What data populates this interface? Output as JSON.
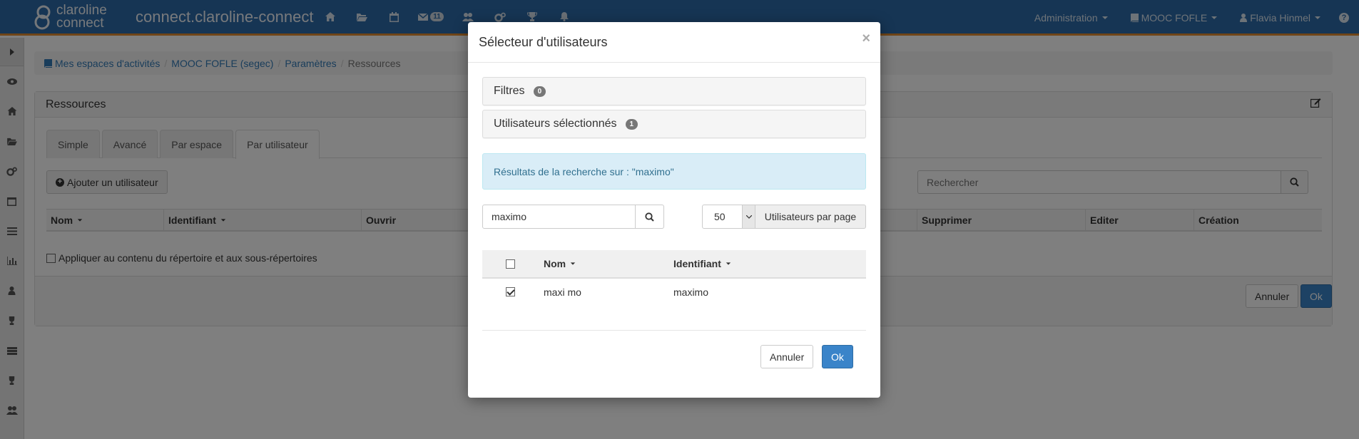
{
  "topnav": {
    "logo_line1": "claroline",
    "logo_line2": "connect",
    "brand": "connect.claroline-connect",
    "messages_count": "11",
    "administration": "Administration",
    "workspace": "MOOC FOFLE",
    "user": "Flavia Hinmel",
    "help": "?"
  },
  "breadcrumb": {
    "items": [
      "Mes espaces d'activités",
      "MOOC FOFLE (segec)",
      "Paramètres"
    ],
    "active": "Ressources"
  },
  "panel": {
    "title": "Ressources",
    "tabs": [
      "Simple",
      "Avancé",
      "Par espace",
      "Par utilisateur"
    ],
    "add_user": "Ajouter un utilisateur",
    "search_placeholder": "Rechercher",
    "columns": [
      "Nom",
      "Identifiant",
      "Ouvrir",
      "Supprimer",
      "Editer",
      "Création"
    ],
    "apply_label": "Appliquer au contenu du répertoire et aux sous-répertoires",
    "annuler": "Annuler",
    "ok": "Ok"
  },
  "modal": {
    "title": "Sélecteur d'utilisateurs",
    "close": "×",
    "filters_label": "Filtres",
    "filters_count": "0",
    "selected_label": "Utilisateurs sélectionnés",
    "selected_count": "1",
    "alert": "Résultats de la recherche sur : \"maximo\"",
    "search_value": "maximo",
    "per_page_value": "50",
    "per_page_label": "Utilisateurs par page",
    "columns": [
      "Nom",
      "Identifiant"
    ],
    "rows": [
      {
        "name": "maxi mo",
        "username": "maximo",
        "checked": true
      }
    ],
    "annuler": "Annuler",
    "ok": "Ok"
  }
}
